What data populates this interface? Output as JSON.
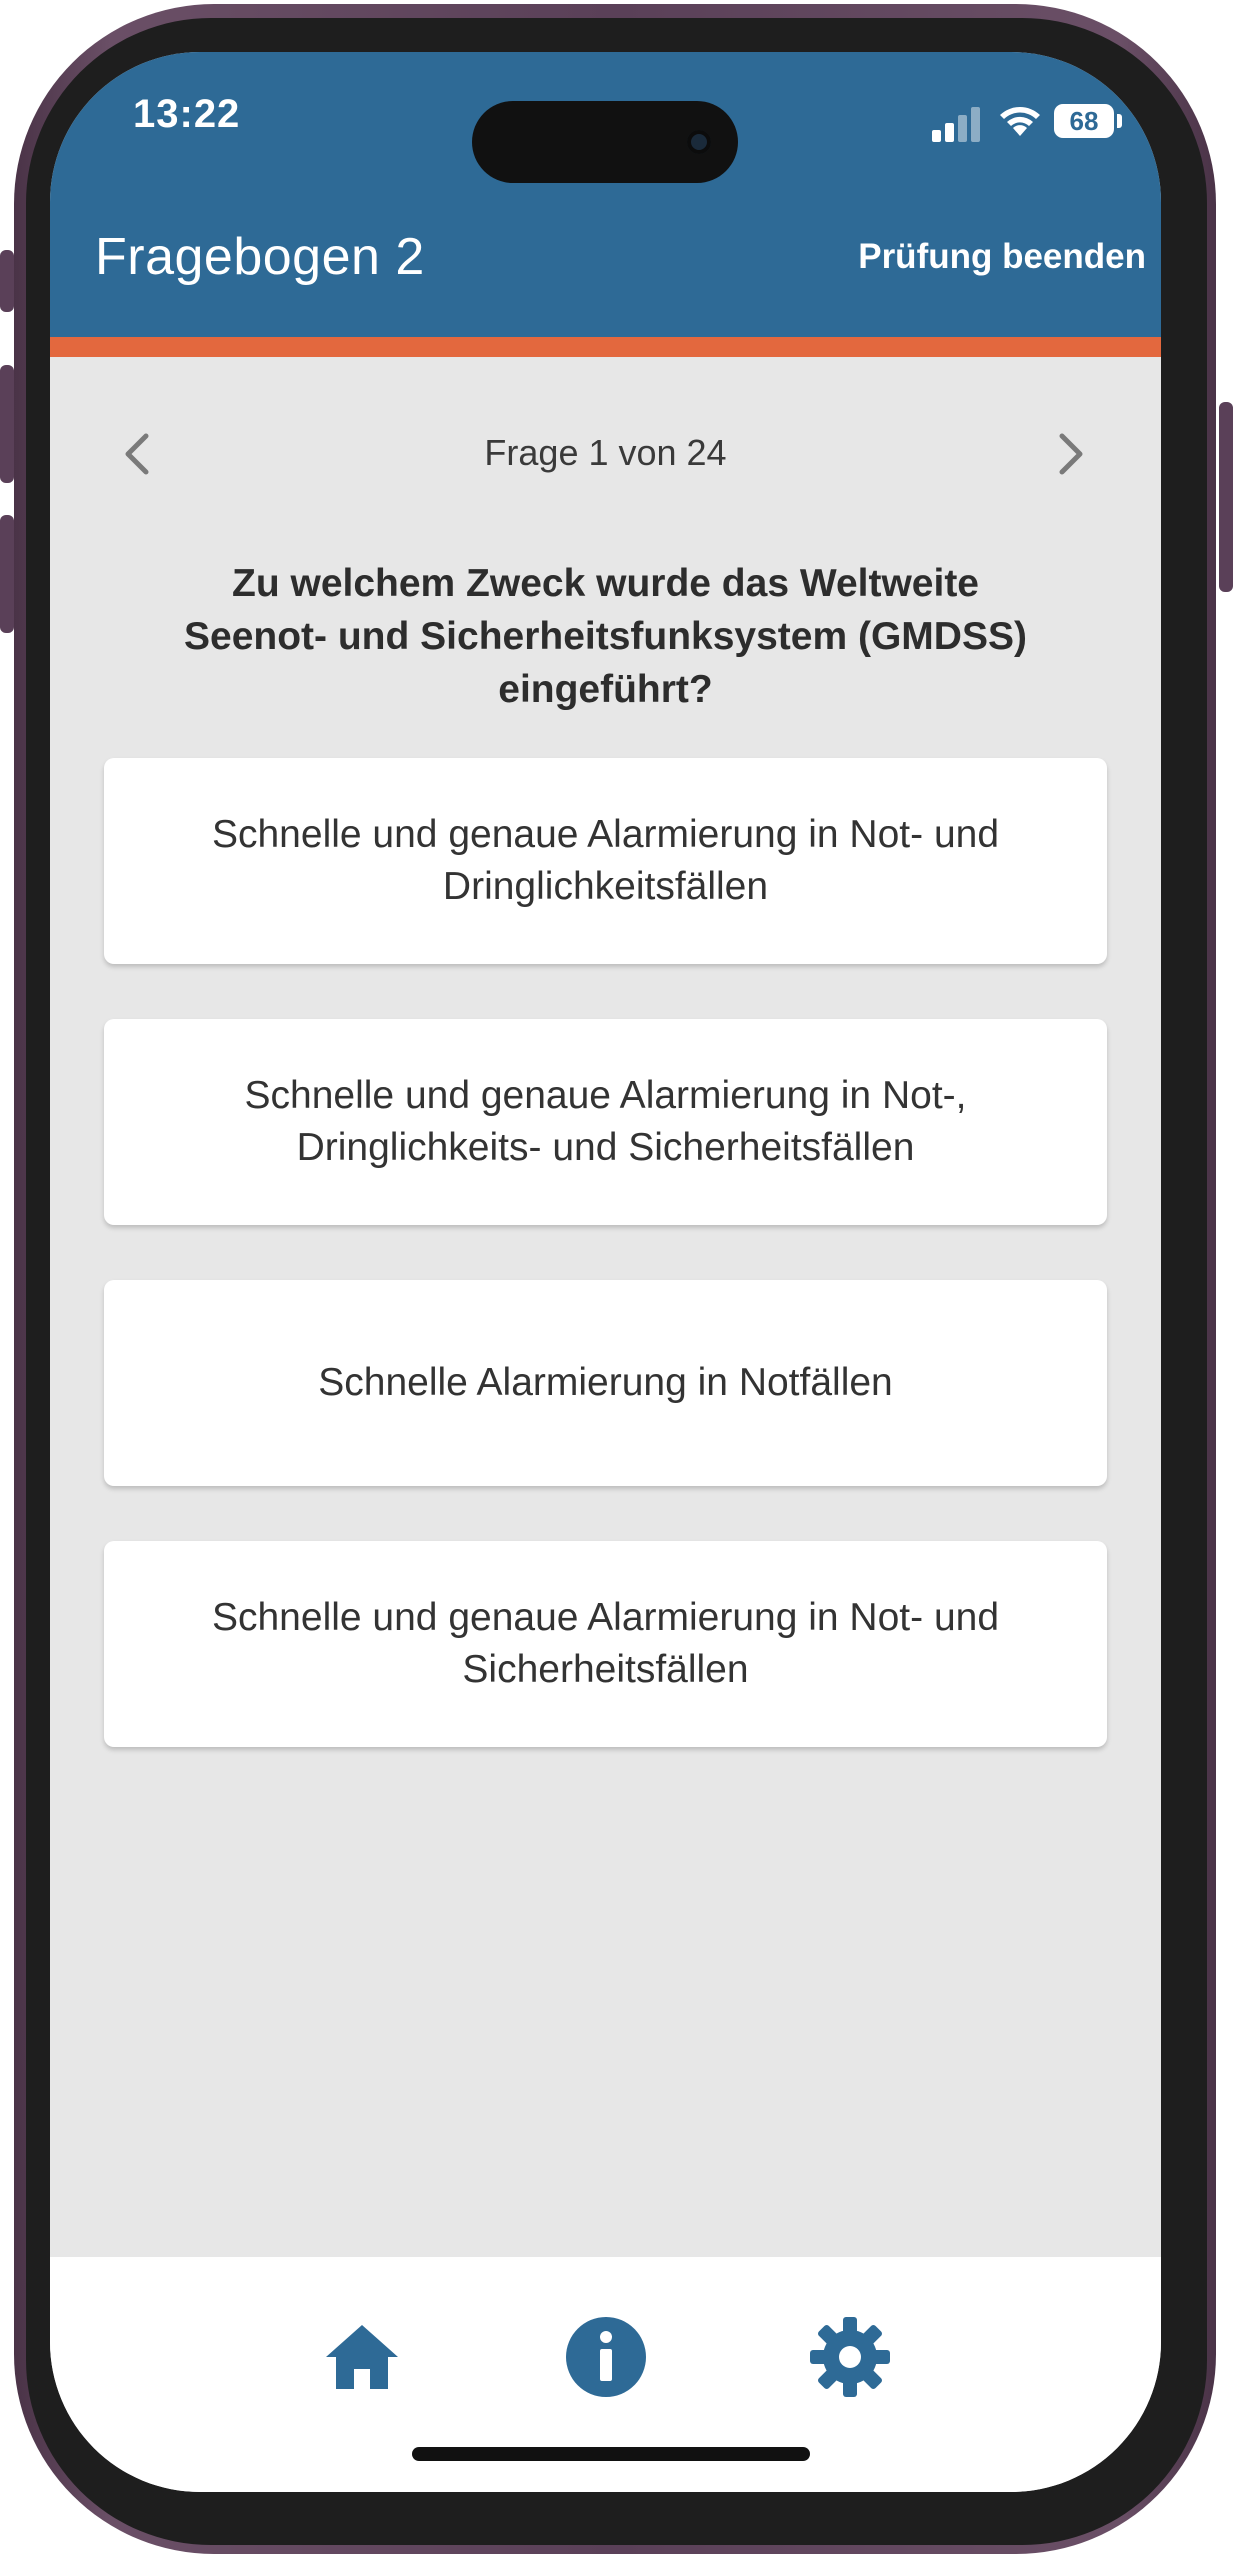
{
  "status_bar": {
    "time": "13:22",
    "battery": "68"
  },
  "header": {
    "title": "Fragebogen 2",
    "end_exam_label": "Prüfung beenden"
  },
  "navigation": {
    "counter": "Frage 1 von 24",
    "prev_icon": "chevron-left-icon",
    "next_icon": "chevron-right-icon"
  },
  "question": {
    "text": "Zu welchem Zweck wurde das Weltweite Seenot- und Sicherheitsfunksystem (GMDSS) eingeführt?"
  },
  "answers": [
    {
      "text": "Schnelle und genaue Alarmierung in Not- und Dringlichkeitsfällen"
    },
    {
      "text": "Schnelle und genaue Alarmierung in Not-, Dringlichkeits- und Sicherheitsfällen"
    },
    {
      "text": "Schnelle Alarmierung in Notfällen"
    },
    {
      "text": "Schnelle und genaue Alarmierung in Not- und Sicherheitsfällen"
    }
  ],
  "bottom_tabs": [
    {
      "icon": "home-icon"
    },
    {
      "icon": "info-icon"
    },
    {
      "icon": "gear-icon"
    }
  ],
  "colors": {
    "header": "#2e6a96",
    "accent": "#e3683e",
    "background": "#e7e7e7",
    "card": "#ffffff",
    "icon": "#2e6a96"
  }
}
